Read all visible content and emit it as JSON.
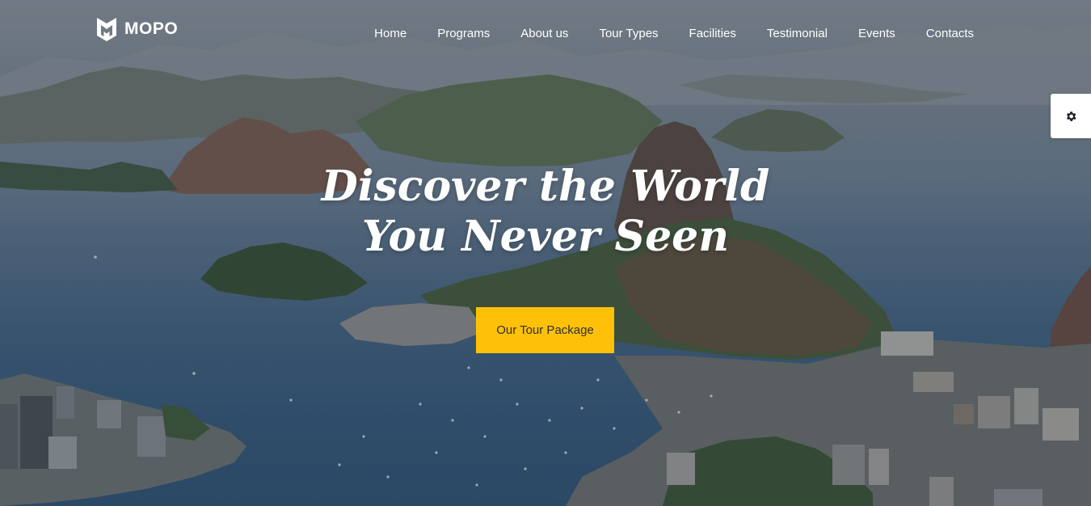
{
  "brand": {
    "name": "MOPO",
    "logo_icon": "m-shield-logo-icon"
  },
  "nav": {
    "items": [
      {
        "label": "Home"
      },
      {
        "label": "Programs"
      },
      {
        "label": "About us"
      },
      {
        "label": "Tour Types"
      },
      {
        "label": "Facilities"
      },
      {
        "label": "Testimonial"
      },
      {
        "label": "Events"
      },
      {
        "label": "Contacts"
      }
    ]
  },
  "settings": {
    "icon": "gear-icon"
  },
  "hero": {
    "headline_line1": "Discover the World",
    "headline_line2": "You Never Seen",
    "cta_label": "Our Tour Package"
  },
  "colors": {
    "accent": "#ffc107",
    "text_light": "#ffffff",
    "cta_text": "#2b2f36",
    "water": "#33587a"
  }
}
